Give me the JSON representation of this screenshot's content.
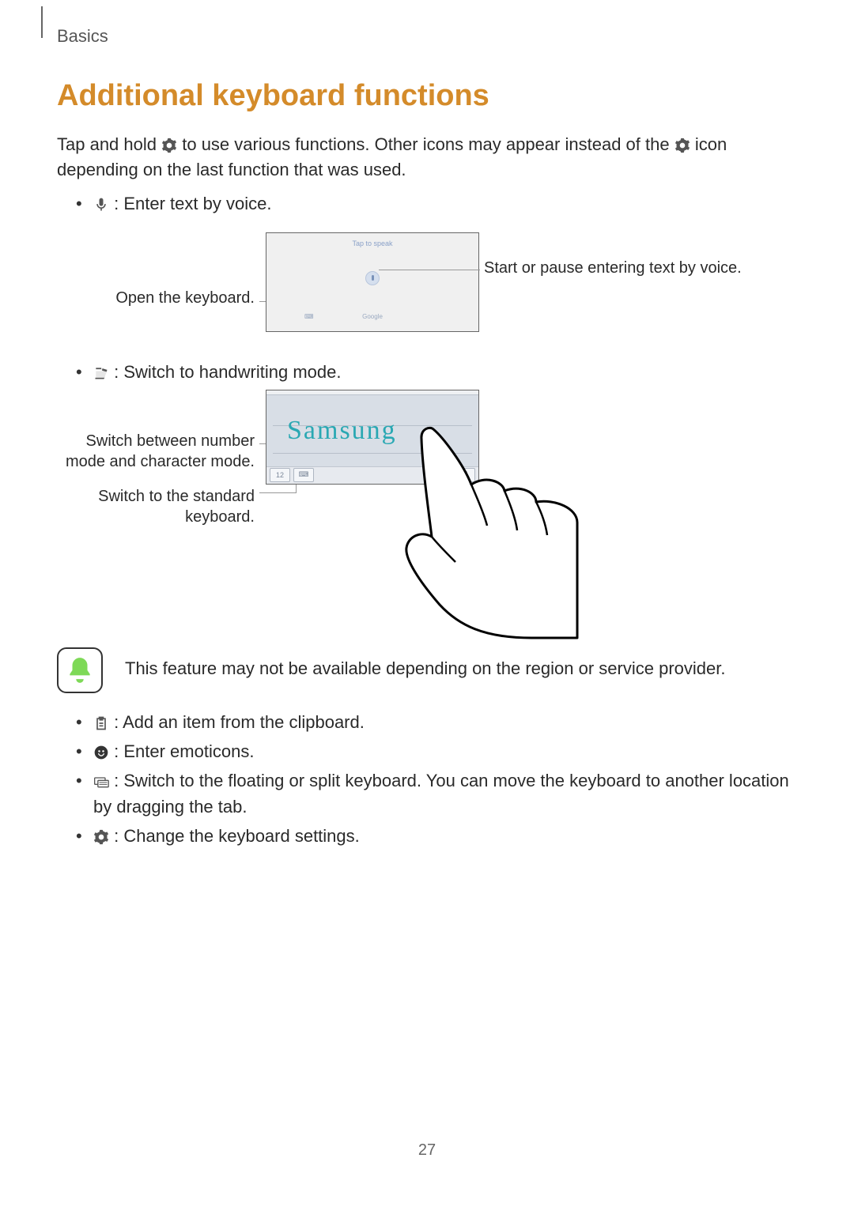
{
  "header": {
    "section": "Basics"
  },
  "title": "Additional keyboard functions",
  "intro_a": "Tap and hold ",
  "intro_b": " to use various functions. Other icons may appear instead of the ",
  "intro_c": " icon depending on the last function that was used.",
  "bullet_voice": " : Enter text by voice.",
  "fig1": {
    "open_keyboard": "Open the keyboard.",
    "start_pause": "Start or pause entering text by voice.",
    "panel_top": "Tap to speak",
    "panel_bottom_center": "Google"
  },
  "bullet_handwriting": " : Switch to handwriting mode.",
  "fig2": {
    "switch_num_char": "Switch between number mode and character mode.",
    "switch_standard": "Switch to the standard keyboard.",
    "sample_text": "Samsung"
  },
  "note": "This feature may not be available depending on the region or service provider.",
  "bullet_clipboard": " : Add an item from the clipboard.",
  "bullet_emoticons": " : Enter emoticons.",
  "bullet_floating": " : Switch to the floating or split keyboard. You can move the keyboard to another location by dragging the tab.",
  "bullet_settings": " : Change the keyboard settings.",
  "page_number": "27"
}
